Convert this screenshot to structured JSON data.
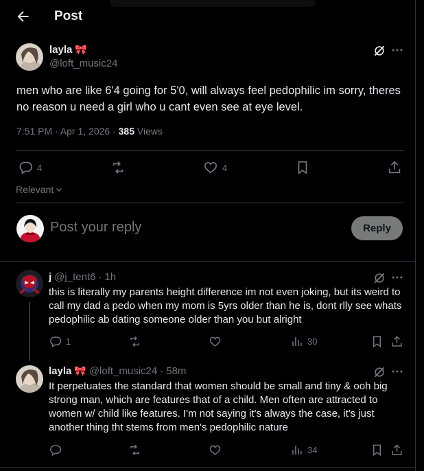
{
  "header": {
    "title": "Post"
  },
  "post": {
    "author_name": "layla",
    "author_emoji": "🎀",
    "author_handle": "@loft_music24",
    "text": "men who are like 6'4 going for 5'0, will always feel pedophilic im sorry, theres no reason u need a girl who u cant even see at eye level.",
    "time": "7:51 PM · Apr 1, 2026 · ",
    "views_count": "385",
    "views_label": " Views",
    "replies": "4",
    "likes": "4",
    "sort_label": "Relevant"
  },
  "composer": {
    "placeholder": "Post your reply",
    "button": "Reply"
  },
  "comments": [
    {
      "name": "j",
      "emoji": "",
      "handle": "@j_tent6",
      "age": "1h",
      "text": "this is literally my parents height difference im not even joking,  but its weird to call my dad a pedo when my mom is 5yrs older than he is, dont rlly see whats pedophilic ab dating someone older than you  but alright",
      "replies": "1",
      "views": "30"
    },
    {
      "name": "layla",
      "emoji": "🎀",
      "handle": "@loft_music24",
      "age": "58m",
      "text": "It perpetuates the standard that women should be small and tiny & ooh big strong man, which are features that of a child. Men often are attracted to women w/ child like features. I'm not saying it's always the case, it's just another thing tht stems from men's pedophilic nature",
      "replies": "",
      "views": "34"
    }
  ],
  "colors": {
    "background": "#000000",
    "text": "#e7e9ea",
    "muted": "#71767b",
    "divider": "#2f3336",
    "reply_button": "#787a7a"
  },
  "icons": [
    "back-arrow-icon",
    "grok-icon",
    "more-icon",
    "reply-icon",
    "repost-icon",
    "like-icon",
    "bookmark-icon",
    "share-icon",
    "views-icon",
    "chevron-down-icon"
  ]
}
